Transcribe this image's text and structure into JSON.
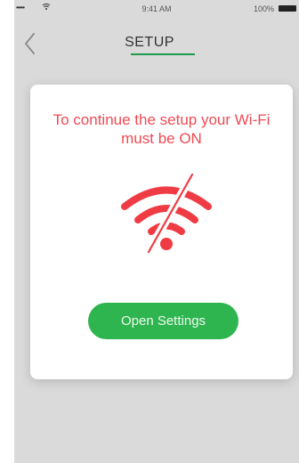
{
  "status_bar": {
    "time": "9:41 AM",
    "battery": "100%",
    "signal": "•••••"
  },
  "header": {
    "title": "SETUP",
    "back_icon": "chevron-left-icon"
  },
  "modal": {
    "message": "To continue the setup your Wi-Fi must be ON",
    "icon": "wifi-off-icon",
    "button_label": "Open Settings"
  },
  "colors": {
    "accent_green": "#2fb54f",
    "title_underline_green": "#1c9b4a",
    "alert_red": "#f04a52"
  }
}
